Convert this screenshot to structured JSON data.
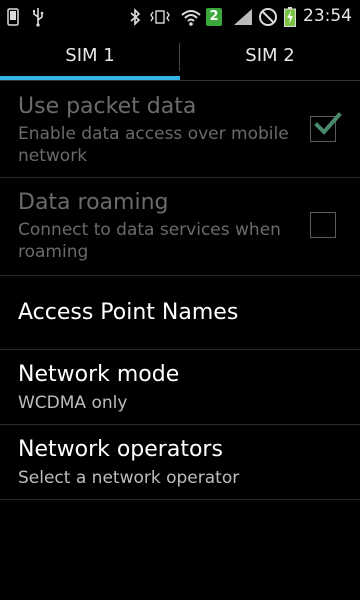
{
  "status_bar": {
    "time": "23:54",
    "sim_badge": "2",
    "icons": [
      "phone-icon",
      "usb-icon",
      "bluetooth-icon",
      "vibrate-icon",
      "wifi-icon",
      "sim2-badge",
      "signal-icon",
      "no-signal-icon",
      "battery-charging-icon"
    ]
  },
  "tabs": [
    {
      "label": "SIM 1",
      "selected": true
    },
    {
      "label": "SIM 2",
      "selected": false
    }
  ],
  "settings": {
    "packet_data": {
      "title": "Use packet data",
      "summary": "Enable data access over mobile network",
      "checked": true,
      "enabled": false
    },
    "roaming": {
      "title": "Data roaming",
      "summary": "Connect to data services when roaming",
      "checked": false,
      "enabled": false
    },
    "apn": {
      "title": "Access Point Names"
    },
    "network_mode": {
      "title": "Network mode",
      "summary": "WCDMA only"
    },
    "operators": {
      "title": "Network operators",
      "summary": "Select a network operator"
    }
  },
  "colors": {
    "accent": "#33b5e5",
    "checkmark": "#4a8a6a",
    "sim_badge": "#3aa83a"
  }
}
